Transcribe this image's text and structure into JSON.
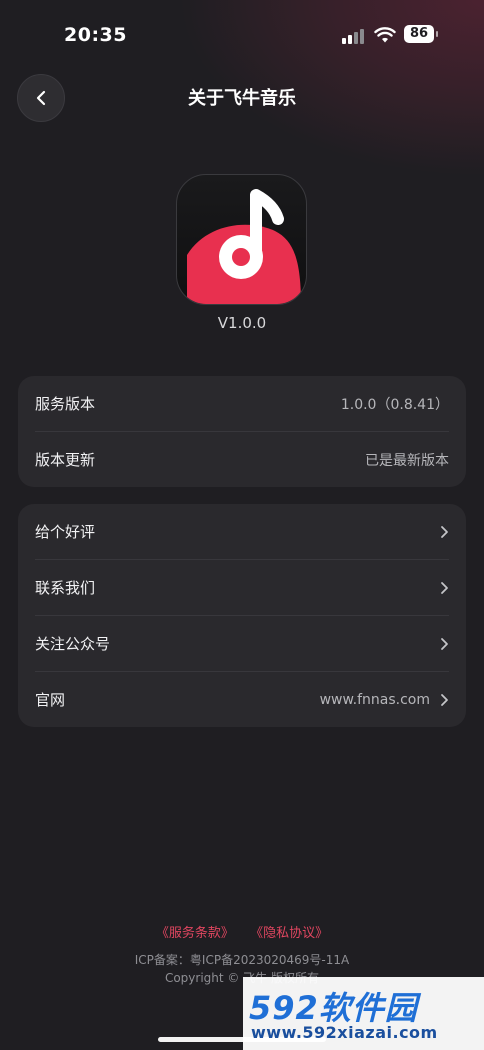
{
  "status_bar": {
    "time": "20:35",
    "battery": "86"
  },
  "header": {
    "title": "关于飞牛音乐",
    "back_icon": "chevron-left-icon"
  },
  "app": {
    "version": "V1.0.0",
    "logo_icon": "music-note-logo",
    "logo_colors": {
      "bg": "#141415",
      "accent": "#e8304f"
    }
  },
  "info_card": {
    "rows": [
      {
        "label": "服务版本",
        "value": "1.0.0（0.8.41）"
      },
      {
        "label": "版本更新",
        "value": "已是最新版本"
      }
    ]
  },
  "action_card": {
    "rows": [
      {
        "label": "给个好评",
        "value": ""
      },
      {
        "label": "联系我们",
        "value": ""
      },
      {
        "label": "关注公众号",
        "value": ""
      },
      {
        "label": "官网",
        "value": "www.fnnas.com"
      }
    ]
  },
  "footer": {
    "terms_link": "《服务条款》",
    "privacy_link": "《隐私协议》",
    "icp": "ICP备案：粤ICP备2023020469号-11A",
    "copyright": "Copyright © 飞牛 版权所有",
    "link_color": "#e04660"
  },
  "watermark": {
    "number": "592",
    "text": "软件园",
    "url": "www.592xiazai.com"
  }
}
